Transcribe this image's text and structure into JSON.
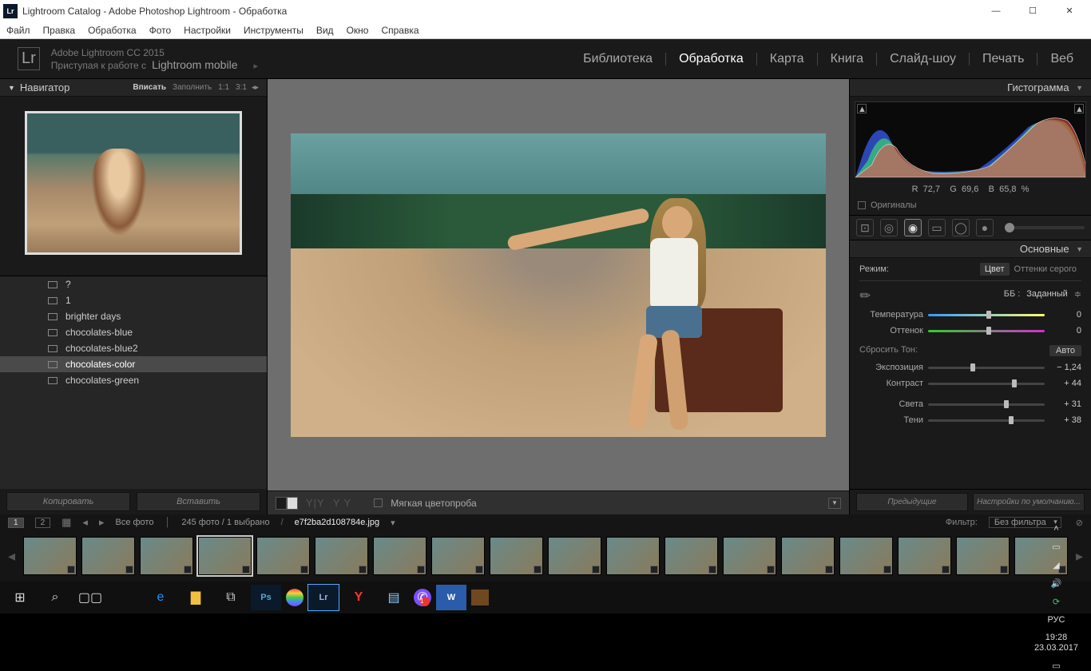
{
  "window_title": "Lightroom Catalog - Adobe Photoshop Lightroom - Обработка",
  "menu": [
    "Файл",
    "Правка",
    "Обработка",
    "Фото",
    "Настройки",
    "Инструменты",
    "Вид",
    "Окно",
    "Справка"
  ],
  "id": {
    "brand": "Lr",
    "ver": "Adobe Lightroom CC 2015",
    "sub": "Приступая к работе с",
    "mobile": "Lightroom mobile"
  },
  "modules": [
    "Библиотека",
    "Обработка",
    "Карта",
    "Книга",
    "Слайд-шоу",
    "Печать",
    "Веб"
  ],
  "active_module": "Обработка",
  "nav": {
    "title": "Навигатор",
    "fit": "Вписать",
    "fill": "Заполнить",
    "r1": "1:1",
    "r3": "3:1"
  },
  "presets": [
    {
      "name": "?"
    },
    {
      "name": "1"
    },
    {
      "name": "brighter days"
    },
    {
      "name": "chocolates-blue"
    },
    {
      "name": "chocolates-blue2"
    },
    {
      "name": "chocolates-color",
      "selected": true
    },
    {
      "name": "chocolates-green"
    }
  ],
  "left_buttons": {
    "copy": "Копировать",
    "paste": "Вставить"
  },
  "toolbar": {
    "softproof": "Мягкая цветопроба"
  },
  "hist": {
    "title": "Гистограмма",
    "info_r": "R",
    "rv": "72,7",
    "info_g": "G",
    "gv": "69,6",
    "info_b": "B",
    "bv": "65,8",
    "pct": "%",
    "orig": "Оригиналы"
  },
  "basic": {
    "title": "Основные",
    "mode": "Режим:",
    "color": "Цвет",
    "gray": "Оттенки серого",
    "wb": "ББ :",
    "wbsel": "Заданный",
    "temp": "Температура",
    "temp_v": "0",
    "tint": "Оттенок",
    "tint_v": "0",
    "tone_reset": "Сбросить Тон:",
    "auto": "Авто",
    "expo": "Экспозиция",
    "expo_v": "− 1,24",
    "contrast": "Контраст",
    "contrast_v": "+ 44",
    "high": "Света",
    "high_v": "+ 31",
    "shad": "Тени",
    "shad_v": "+ 38"
  },
  "right_buttons": {
    "prev": "Предыдущие",
    "reset": "Настройки по умолчанию..."
  },
  "strip": {
    "all": "Все фото",
    "count": "245",
    "photo_word": "фото",
    "sel": "1",
    "sel_word": "выбрано",
    "filename": "e7f2ba2d108784e.jpg",
    "filter": "Фильтр:",
    "filter_sel": "Без фильтра"
  },
  "task": {
    "lang": "РУС",
    "time": "19:28",
    "date": "23.03.2017"
  }
}
